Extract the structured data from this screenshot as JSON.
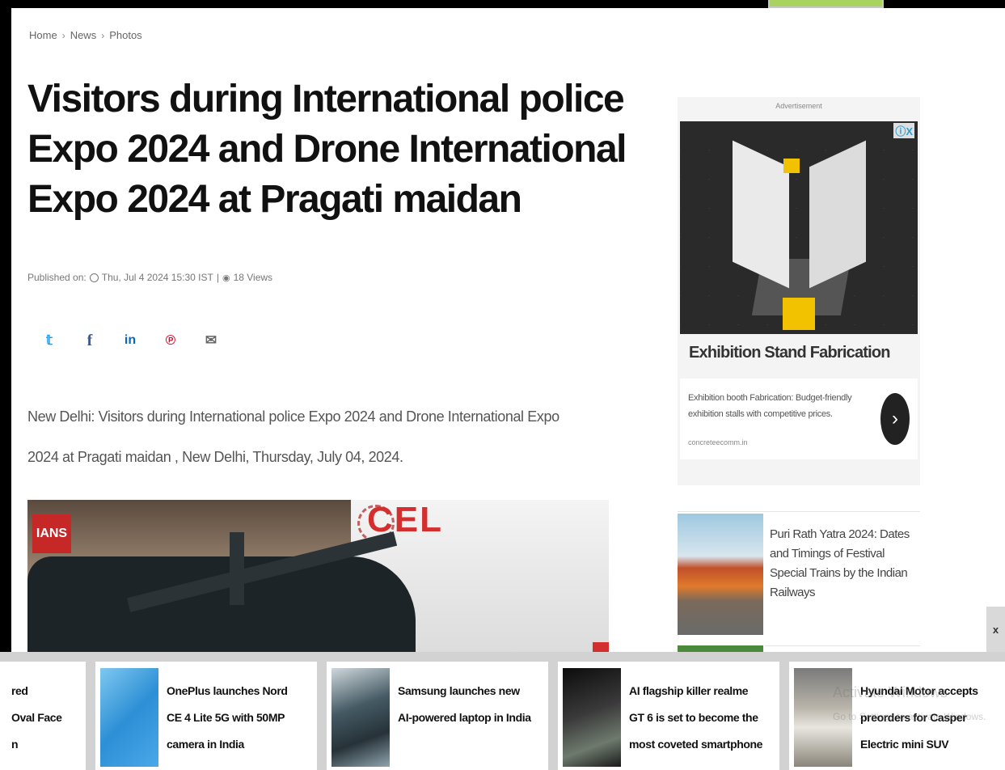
{
  "breadcrumb": {
    "items": [
      "Home",
      "News",
      "Photos"
    ],
    "separator": "›"
  },
  "article": {
    "title": "Visitors during International police Expo 2024 and Drone International Expo 2024 at Pragati maidan",
    "meta": {
      "published_label": "Published on:",
      "date": "Thu, Jul 4 2024 15:30 IST",
      "divider": "|",
      "views": "18 Views"
    },
    "share": {
      "twitter": "𝕥",
      "facebook": "f",
      "linkedin": "in",
      "pinterest": "℗",
      "email": "✉"
    },
    "lead": "New Delhi: Visitors during International police Expo 2024 and Drone International Expo 2024 at Pragati maidan , New Delhi, Thursday, July 04, 2024.",
    "photo": {
      "badge": "IANS",
      "sign_text": "CEL"
    }
  },
  "ad": {
    "label": "Advertisement",
    "close": "ⓘX",
    "headline": "Exhibition Stand Fabrication",
    "description": "Exhibition booth Fabrication: Budget-friendly exhibition stalls with competitive prices.",
    "domain": "concreteecomm.in",
    "arrow": "›"
  },
  "related": {
    "title": "Puri Rath Yatra 2024: Dates and Timings of Festival Special Trains by the Indian Railways"
  },
  "ticker": {
    "close": "x",
    "cards": [
      {
        "text_lines": [
          "red",
          "Oval Face",
          "n"
        ]
      },
      {
        "text_lines": [
          "OnePlus launches Nord",
          "CE 4 Lite 5G with 50MP",
          "camera in India"
        ]
      },
      {
        "text_lines": [
          "Samsung launches new",
          "AI-powered laptop in India"
        ]
      },
      {
        "text_lines": [
          "AI flagship killer realme",
          "GT 6 is set to become the",
          "most coveted smartphone"
        ]
      },
      {
        "text_lines": [
          "Hyundai Motor accepts",
          "preorders for Casper",
          "Electric mini SUV"
        ]
      }
    ]
  },
  "watermark": {
    "line1": "Activate Windows",
    "line2": "Go to Settings to activate Windows."
  }
}
